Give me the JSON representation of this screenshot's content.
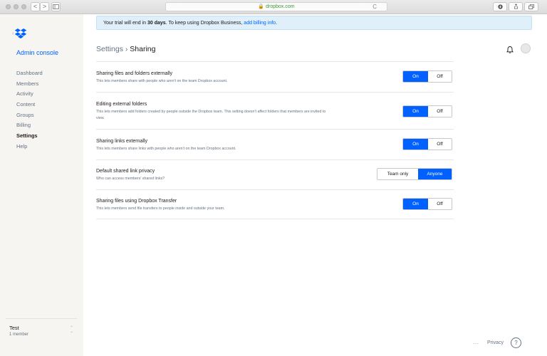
{
  "browser": {
    "url": "dropbox.com",
    "nav_back": "<",
    "nav_forward": ">",
    "reload": "C"
  },
  "sidebar": {
    "admin_title": "Admin console",
    "items": [
      {
        "label": "Dashboard"
      },
      {
        "label": "Members"
      },
      {
        "label": "Activity"
      },
      {
        "label": "Content"
      },
      {
        "label": "Groups"
      },
      {
        "label": "Billing"
      },
      {
        "label": "Settings"
      },
      {
        "label": "Help"
      }
    ],
    "active_item": "Settings",
    "team": {
      "name": "Test",
      "count": "1 member"
    }
  },
  "banner": {
    "prefix": "Your trial will end in ",
    "days": "30 days",
    "middle": ". To keep using Dropbox Business, ",
    "link": "add billing info",
    "suffix": "."
  },
  "header": {
    "parent": "Settings",
    "separator": "›",
    "current": "Sharing"
  },
  "settings": [
    {
      "title": "Sharing files and folders externally",
      "description": "This lets members share with people who aren't on the team Dropbox account.",
      "options": [
        "On",
        "Off"
      ],
      "selected": "On"
    },
    {
      "title": "Editing external folders",
      "description": "This lets members add folders created by people outside the Dropbox team. This setting doesn't affect folders that members are invited to view.",
      "options": [
        "On",
        "Off"
      ],
      "selected": "On"
    },
    {
      "title": "Sharing links externally",
      "description": "This lets members share links with people who aren't on the team Dropbox account.",
      "options": [
        "On",
        "Off"
      ],
      "selected": "On"
    },
    {
      "title": "Default shared link privacy",
      "description": "Who can access members' shared links?",
      "options": [
        "Team only",
        "Anyone"
      ],
      "selected": "Anyone"
    },
    {
      "title": "Sharing files using Dropbox Transfer",
      "description": "This lets members send file transfers to people inside and outside your team.",
      "options": [
        "On",
        "Off"
      ],
      "selected": "On"
    }
  ],
  "footer": {
    "more": "...",
    "privacy": "Privacy",
    "help": "?"
  },
  "colors": {
    "accent": "#0061fe",
    "sidebar_bg": "#f7f5f2",
    "banner_bg": "#e0f0fb"
  },
  "icons": [
    "dropbox-logo-icon",
    "back-chevron-icon",
    "bell-icon",
    "help-icon"
  ]
}
